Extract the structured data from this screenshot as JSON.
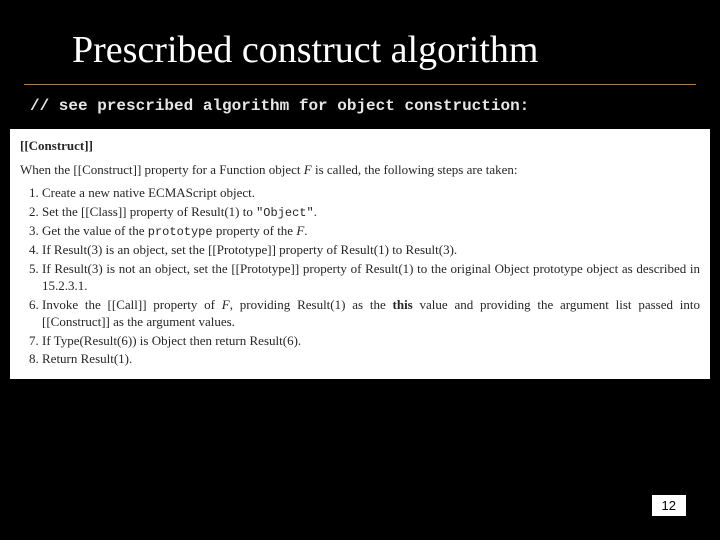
{
  "title": "Prescribed construct algorithm",
  "comment": "// see prescribed algorithm for object construction:",
  "spec": {
    "heading": "[[Construct]]",
    "intro_parts": {
      "p1": "When the [[Construct]] property for a Function object ",
      "F": "F",
      "p2": " is called, the following steps are taken:"
    },
    "steps": [
      {
        "pre": "Create a new native ECMAScript object."
      },
      {
        "pre": "Set the [[Class]] property of Result(1) to ",
        "mono": "\"Object\"",
        "post": "."
      },
      {
        "pre": "Get the value of the ",
        "mono": "prototype",
        "post_parts": {
          "a": " property of the ",
          "F": "F",
          "b": "."
        }
      },
      {
        "pre": "If Result(3) is an object, set the [[Prototype]] property of Result(1) to Result(3)."
      },
      {
        "pre": "If Result(3) is not an object, set the [[Prototype]] property of Result(1) to the original Object prototype object as described in 15.2.3.1."
      },
      {
        "pre_parts": {
          "a": "Invoke the [[Call]] property of ",
          "F": "F",
          "b": ", providing Result(1) as the "
        },
        "bold": "this",
        "post": " value and providing the argument list passed into [[Construct]] as the argument values."
      },
      {
        "pre": "If Type(Result(6)) is Object then return Result(6)."
      },
      {
        "pre": "Return Result(1)."
      }
    ]
  },
  "page_number": "12"
}
